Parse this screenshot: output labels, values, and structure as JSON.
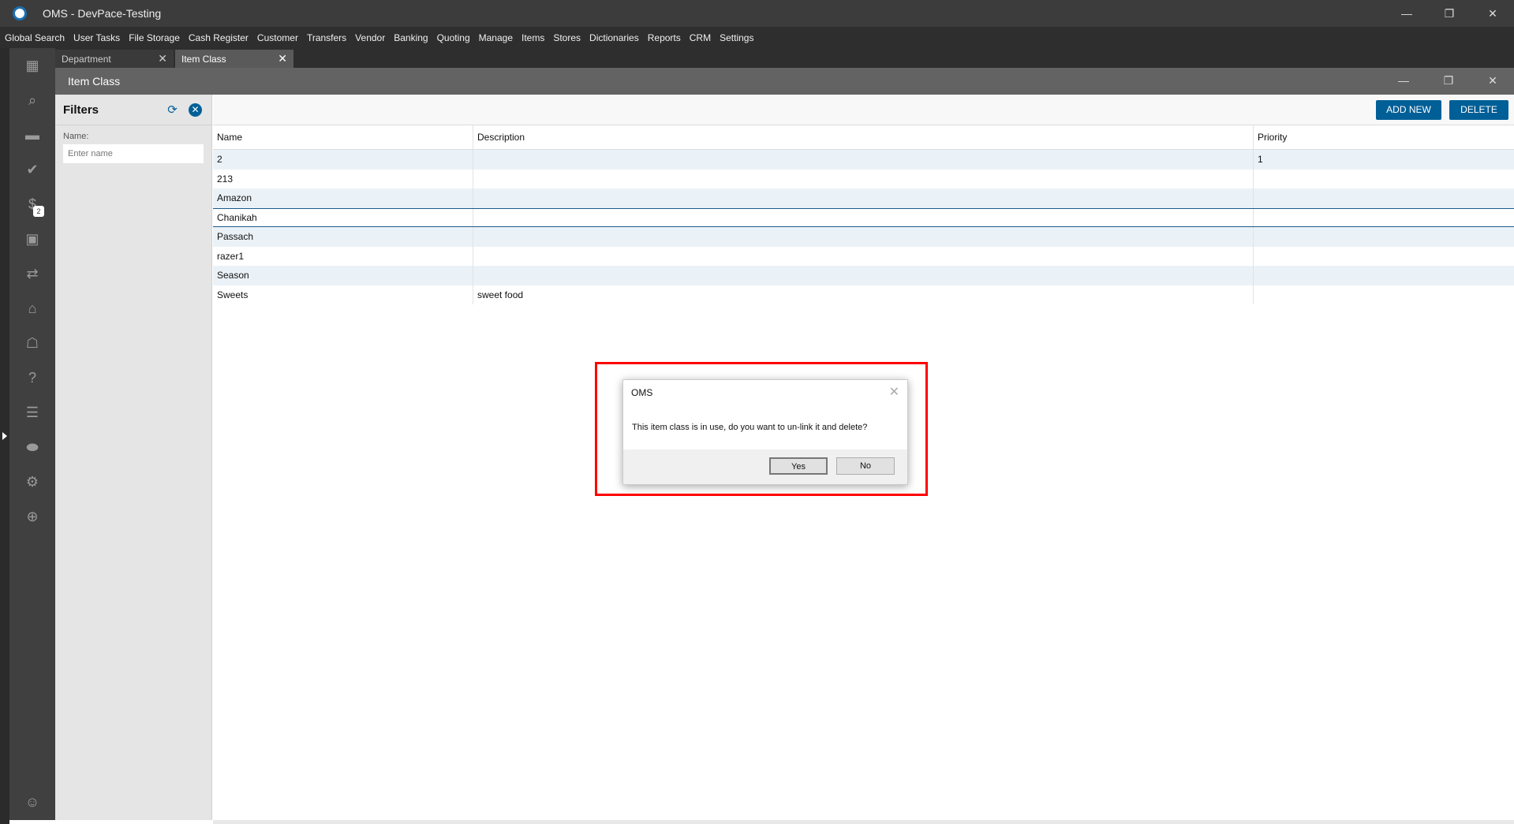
{
  "app": {
    "title": "OMS - DevPace-Testing"
  },
  "menu": [
    "Global Search",
    "User Tasks",
    "File Storage",
    "Cash Register",
    "Customer",
    "Transfers",
    "Vendor",
    "Banking",
    "Quoting",
    "Manage",
    "Items",
    "Stores",
    "Dictionaries",
    "Reports",
    "CRM",
    "Settings"
  ],
  "sidebar": {
    "task_badge": "2",
    "icons": [
      "dashboard-icon",
      "search-icon",
      "folder-icon",
      "tasks-icon",
      "dollar-icon",
      "contact-icon",
      "transfer-icon",
      "store-icon",
      "bank-icon",
      "quote-icon",
      "clipboard-icon",
      "tag-icon",
      "gear-icon",
      "globe-icon"
    ]
  },
  "tabs": [
    {
      "label": "Department"
    },
    {
      "label": "Item Class"
    }
  ],
  "window": {
    "title": "Item Class"
  },
  "filters": {
    "title": "Filters",
    "name_label": "Name:",
    "name_placeholder": "Enter name",
    "name_value": ""
  },
  "toolbar": {
    "add_new": "ADD NEW",
    "delete": "DELETE"
  },
  "table": {
    "headers": [
      "Name",
      "Description",
      "Priority"
    ],
    "rows": [
      [
        "2",
        "",
        "1"
      ],
      [
        "213",
        "",
        ""
      ],
      [
        "Amazon",
        "",
        ""
      ],
      [
        "Chanikah",
        "",
        ""
      ],
      [
        "Passach",
        "",
        ""
      ],
      [
        "razer1",
        "",
        ""
      ],
      [
        "Season",
        "",
        ""
      ],
      [
        "Sweets",
        "sweet food",
        ""
      ]
    ]
  },
  "dialog": {
    "title": "OMS",
    "message": "This item class is in use, do you want to un-link it and delete?",
    "yes": "Yes",
    "no": "No"
  },
  "colors": {
    "accent": "#005f97",
    "highlight": "#ff0000"
  }
}
